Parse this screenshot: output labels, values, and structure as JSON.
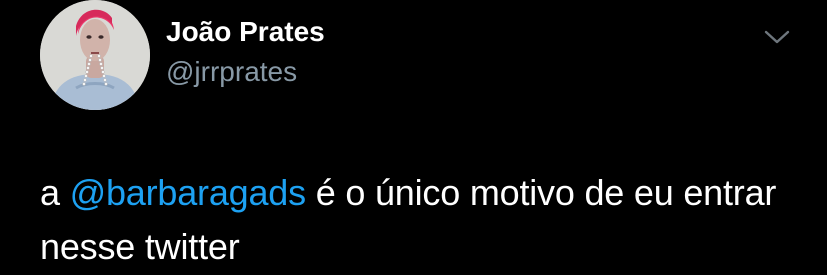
{
  "tweet": {
    "author": {
      "display_name": "João Prates",
      "handle": "@jrrprates"
    },
    "text": {
      "prefix": "a ",
      "mention": "@barbaragads",
      "suffix": " é o único motivo de eu entrar nesse twitter"
    },
    "menu_icon": "chevron-down-icon"
  },
  "colors": {
    "background": "#000000",
    "text": "#ffffff",
    "secondary_text": "#8899a6",
    "mention": "#1da1f2"
  }
}
